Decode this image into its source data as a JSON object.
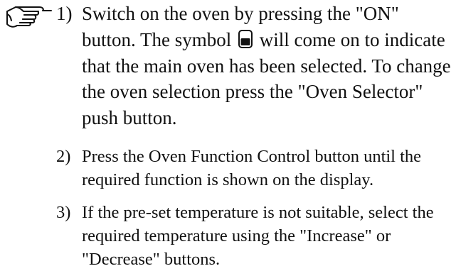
{
  "icons": {
    "pointing_hand": "pointing-hand-icon",
    "main_oven_symbol": "main-oven-symbol-icon"
  },
  "steps": [
    {
      "number": "1)",
      "text_before_symbol": "Switch on the oven by pressing the \"ON\" button. The symbol",
      "text_after_symbol": "will come on to indicate that the main oven has been selected. To change the oven selection press the \"Oven Selector\" push button."
    },
    {
      "number": "2)",
      "text": "Press the Oven Function Control button until the required function is shown on the display."
    },
    {
      "number": "3)",
      "text": "If the pre-set temperature is not suitable, select the required temperature using the \"Increase\" or \"Decrease\" buttons."
    }
  ]
}
